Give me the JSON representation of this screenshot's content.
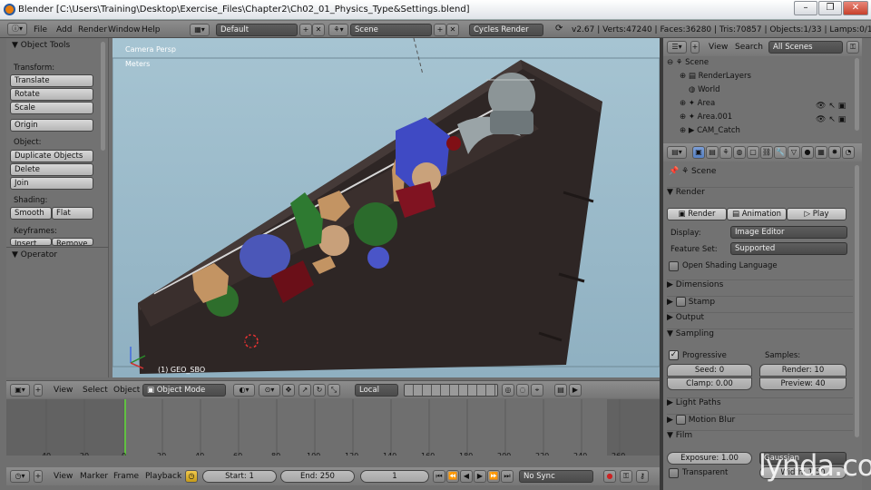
{
  "window": {
    "title": "Blender [C:\\Users\\Training\\Desktop\\Exercise_Files\\Chapter2\\Ch02_01_Physics_Type&Settings.blend]",
    "controls": {
      "minimize": "–",
      "maximize": "❐",
      "close": "✕"
    }
  },
  "info_header": {
    "menus": [
      "File",
      "Add",
      "Render",
      "Window",
      "Help"
    ],
    "screen_layout": "Default",
    "scene": "Scene",
    "render_engine": "Cycles Render",
    "stats": "v2.67 | Verts:47240 | Faces:36280 | Tris:70857 | Objects:1/33 | Lamps:0/1 | Mem:26"
  },
  "tool_shelf": {
    "header": "Object Tools",
    "transform_label": "Transform:",
    "transform_buttons": [
      "Translate",
      "Rotate",
      "Scale"
    ],
    "origin_button": "Origin",
    "object_label": "Object:",
    "object_buttons": [
      "Duplicate Objects",
      "Delete",
      "Join"
    ],
    "shading_label": "Shading:",
    "shading_buttons": [
      "Smooth",
      "Flat"
    ],
    "keyframes_label": "Keyframes:",
    "keyframe_buttons": [
      "Insert",
      "Remove"
    ],
    "operator_header": "Operator"
  },
  "viewport": {
    "view_name": "Camera Persp",
    "units": "Meters",
    "active_object": "(1) GEO_SBO"
  },
  "view3d_header": {
    "menus": [
      "View",
      "Select",
      "Object"
    ],
    "mode": "Object Mode",
    "orientation": "Local"
  },
  "timeline": {
    "frame_labels": [
      "-40",
      "-20",
      "0",
      "20",
      "40",
      "60",
      "80",
      "100",
      "120",
      "140",
      "160",
      "180",
      "200",
      "220",
      "240",
      "260"
    ],
    "menus": [
      "View",
      "Marker",
      "Frame",
      "Playback"
    ],
    "start": "Start: 1",
    "end": "End: 250",
    "current": "1",
    "sync": "No Sync"
  },
  "outliner": {
    "view": "View",
    "search": "Search",
    "filter": "All Scenes",
    "items": [
      "Scene",
      "RenderLayers",
      "World",
      "Area",
      "Area.001",
      "CAM_Catch"
    ]
  },
  "properties": {
    "breadcrumb": "Scene",
    "render_panel": "Render",
    "render_buttons": [
      "Render",
      "Animation",
      "Play"
    ],
    "display_label": "Display:",
    "display_value": "Image Editor",
    "feature_set_label": "Feature Set:",
    "feature_set_value": "Supported",
    "open_shading_language": "Open Shading Language",
    "panels_collapsed": [
      "Dimensions",
      "Stamp",
      "Output"
    ],
    "sampling_panel": "Sampling",
    "progressive": "Progressive",
    "samples_label": "Samples:",
    "seed": "Seed: 0",
    "clamp": "Clamp: 0.00",
    "render_samples": "Render: 10",
    "preview_samples": "Preview: 40",
    "light_paths": "Light Paths",
    "motion_blur": "Motion Blur",
    "film": "Film",
    "exposure": "Exposure: 1.00",
    "filter_type": "Gaussian",
    "transparent": "Transparent",
    "width": "Width: 1.50"
  },
  "watermark": "lynda.com",
  "colors": {
    "accent_orange": "#e87d0d",
    "active_blue": "#5680c2",
    "frame_marker": "#61c042"
  }
}
